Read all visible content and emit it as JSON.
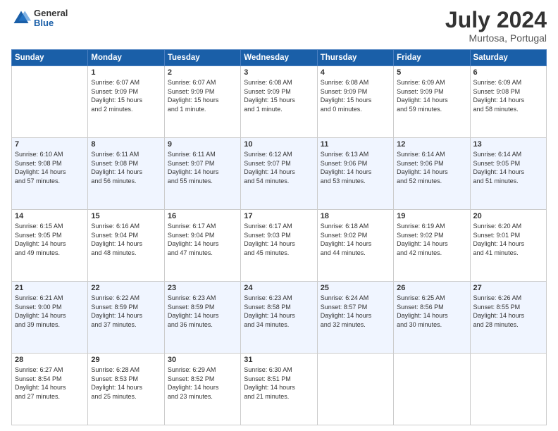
{
  "header": {
    "logo_general": "General",
    "logo_blue": "Blue",
    "month": "July 2024",
    "location": "Murtosa, Portugal"
  },
  "days_of_week": [
    "Sunday",
    "Monday",
    "Tuesday",
    "Wednesday",
    "Thursday",
    "Friday",
    "Saturday"
  ],
  "weeks": [
    [
      {
        "day": "",
        "info": ""
      },
      {
        "day": "1",
        "info": "Sunrise: 6:07 AM\nSunset: 9:09 PM\nDaylight: 15 hours\nand 2 minutes."
      },
      {
        "day": "2",
        "info": "Sunrise: 6:07 AM\nSunset: 9:09 PM\nDaylight: 15 hours\nand 1 minute."
      },
      {
        "day": "3",
        "info": "Sunrise: 6:08 AM\nSunset: 9:09 PM\nDaylight: 15 hours\nand 1 minute."
      },
      {
        "day": "4",
        "info": "Sunrise: 6:08 AM\nSunset: 9:09 PM\nDaylight: 15 hours\nand 0 minutes."
      },
      {
        "day": "5",
        "info": "Sunrise: 6:09 AM\nSunset: 9:09 PM\nDaylight: 14 hours\nand 59 minutes."
      },
      {
        "day": "6",
        "info": "Sunrise: 6:09 AM\nSunset: 9:08 PM\nDaylight: 14 hours\nand 58 minutes."
      }
    ],
    [
      {
        "day": "7",
        "info": "Sunrise: 6:10 AM\nSunset: 9:08 PM\nDaylight: 14 hours\nand 57 minutes."
      },
      {
        "day": "8",
        "info": "Sunrise: 6:11 AM\nSunset: 9:08 PM\nDaylight: 14 hours\nand 56 minutes."
      },
      {
        "day": "9",
        "info": "Sunrise: 6:11 AM\nSunset: 9:07 PM\nDaylight: 14 hours\nand 55 minutes."
      },
      {
        "day": "10",
        "info": "Sunrise: 6:12 AM\nSunset: 9:07 PM\nDaylight: 14 hours\nand 54 minutes."
      },
      {
        "day": "11",
        "info": "Sunrise: 6:13 AM\nSunset: 9:06 PM\nDaylight: 14 hours\nand 53 minutes."
      },
      {
        "day": "12",
        "info": "Sunrise: 6:14 AM\nSunset: 9:06 PM\nDaylight: 14 hours\nand 52 minutes."
      },
      {
        "day": "13",
        "info": "Sunrise: 6:14 AM\nSunset: 9:05 PM\nDaylight: 14 hours\nand 51 minutes."
      }
    ],
    [
      {
        "day": "14",
        "info": "Sunrise: 6:15 AM\nSunset: 9:05 PM\nDaylight: 14 hours\nand 49 minutes."
      },
      {
        "day": "15",
        "info": "Sunrise: 6:16 AM\nSunset: 9:04 PM\nDaylight: 14 hours\nand 48 minutes."
      },
      {
        "day": "16",
        "info": "Sunrise: 6:17 AM\nSunset: 9:04 PM\nDaylight: 14 hours\nand 47 minutes."
      },
      {
        "day": "17",
        "info": "Sunrise: 6:17 AM\nSunset: 9:03 PM\nDaylight: 14 hours\nand 45 minutes."
      },
      {
        "day": "18",
        "info": "Sunrise: 6:18 AM\nSunset: 9:02 PM\nDaylight: 14 hours\nand 44 minutes."
      },
      {
        "day": "19",
        "info": "Sunrise: 6:19 AM\nSunset: 9:02 PM\nDaylight: 14 hours\nand 42 minutes."
      },
      {
        "day": "20",
        "info": "Sunrise: 6:20 AM\nSunset: 9:01 PM\nDaylight: 14 hours\nand 41 minutes."
      }
    ],
    [
      {
        "day": "21",
        "info": "Sunrise: 6:21 AM\nSunset: 9:00 PM\nDaylight: 14 hours\nand 39 minutes."
      },
      {
        "day": "22",
        "info": "Sunrise: 6:22 AM\nSunset: 8:59 PM\nDaylight: 14 hours\nand 37 minutes."
      },
      {
        "day": "23",
        "info": "Sunrise: 6:23 AM\nSunset: 8:59 PM\nDaylight: 14 hours\nand 36 minutes."
      },
      {
        "day": "24",
        "info": "Sunrise: 6:23 AM\nSunset: 8:58 PM\nDaylight: 14 hours\nand 34 minutes."
      },
      {
        "day": "25",
        "info": "Sunrise: 6:24 AM\nSunset: 8:57 PM\nDaylight: 14 hours\nand 32 minutes."
      },
      {
        "day": "26",
        "info": "Sunrise: 6:25 AM\nSunset: 8:56 PM\nDaylight: 14 hours\nand 30 minutes."
      },
      {
        "day": "27",
        "info": "Sunrise: 6:26 AM\nSunset: 8:55 PM\nDaylight: 14 hours\nand 28 minutes."
      }
    ],
    [
      {
        "day": "28",
        "info": "Sunrise: 6:27 AM\nSunset: 8:54 PM\nDaylight: 14 hours\nand 27 minutes."
      },
      {
        "day": "29",
        "info": "Sunrise: 6:28 AM\nSunset: 8:53 PM\nDaylight: 14 hours\nand 25 minutes."
      },
      {
        "day": "30",
        "info": "Sunrise: 6:29 AM\nSunset: 8:52 PM\nDaylight: 14 hours\nand 23 minutes."
      },
      {
        "day": "31",
        "info": "Sunrise: 6:30 AM\nSunset: 8:51 PM\nDaylight: 14 hours\nand 21 minutes."
      },
      {
        "day": "",
        "info": ""
      },
      {
        "day": "",
        "info": ""
      },
      {
        "day": "",
        "info": ""
      }
    ]
  ]
}
